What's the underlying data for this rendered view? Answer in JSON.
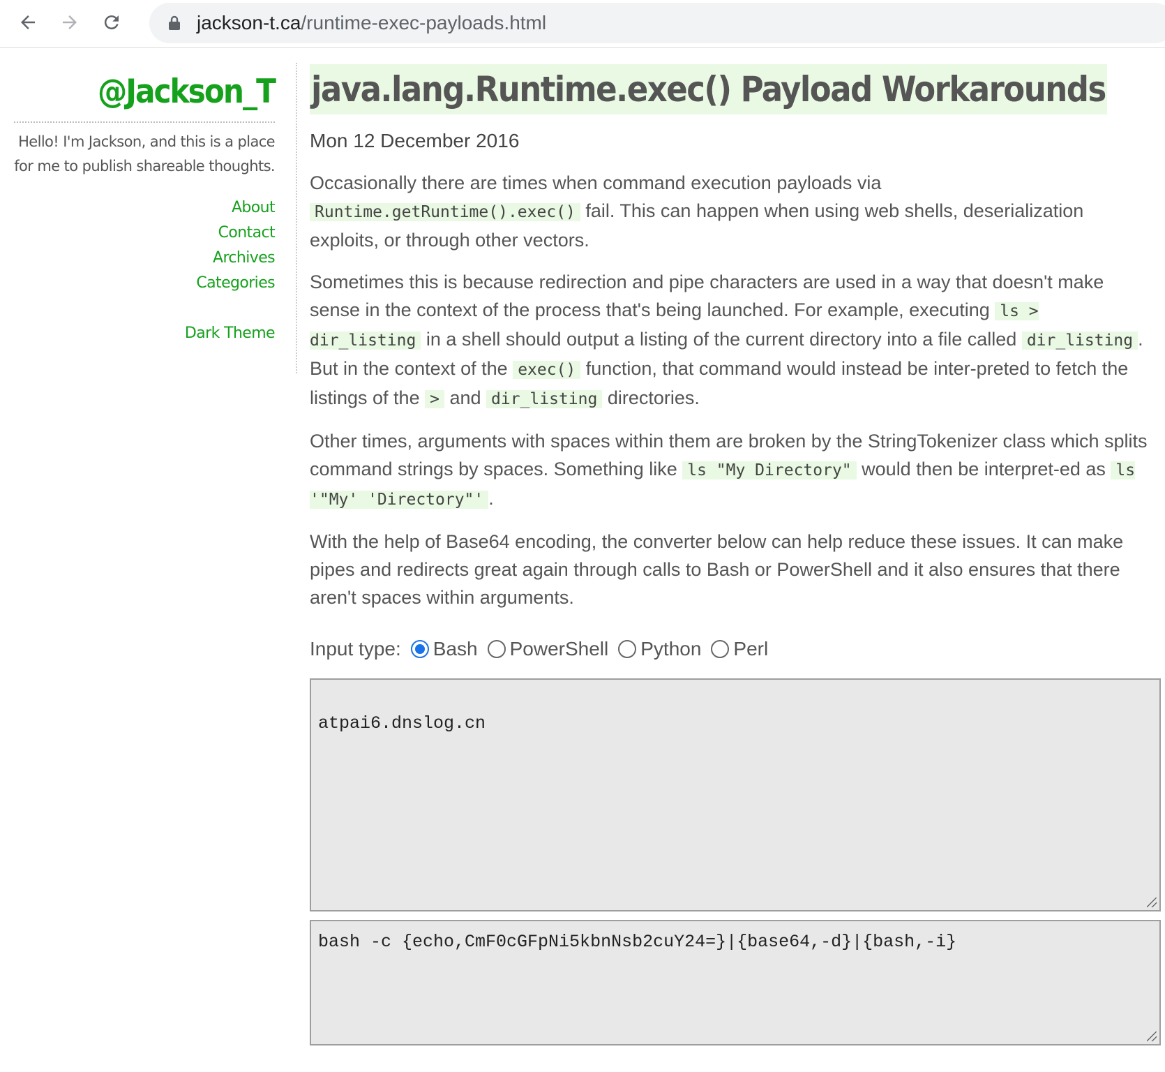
{
  "browser": {
    "url_host": "jackson-t.ca",
    "url_path": "/runtime-exec-payloads.html",
    "icons": [
      "back-arrow-icon",
      "forward-arrow-icon",
      "reload-icon",
      "lock-icon"
    ]
  },
  "sidebar": {
    "title": "@Jackson_T",
    "tagline_line1": "Hello! I'm Jackson, and this is a place",
    "tagline_line2": "for me to publish shareable thoughts.",
    "links": [
      "About",
      "Contact",
      "Archives",
      "Categories"
    ],
    "dark_theme": "Dark Theme",
    "link_color": "#16a11c"
  },
  "post": {
    "title": "java.lang.Runtime.exec() Payload Workarounds",
    "date": "Mon 12 December 2016",
    "p1": {
      "a": "Occasionally there are times when command execution payloads via ",
      "code1": "Runtime.getRuntime().exec()",
      "b": " fail. This can happen when using web shells, deserialization exploits, or through other vectors."
    },
    "p2": {
      "a": "Sometimes this is because redirection and pipe characters are used in a way that doesn't make sense in the context of the process that's being launched. For example, executing ",
      "code1": "ls > dir_listing",
      "b": " in a shell should output a listing of the current directory into a file called ",
      "code2": "dir_listing",
      "c": ". But in the context of the ",
      "code3": "exec()",
      "d": " function, that command would instead be inter-preted to fetch the listings of the ",
      "code4": ">",
      "e": " and ",
      "code5": "dir_listing",
      "f": " directories."
    },
    "p3": {
      "a": "Other times, arguments with spaces within them are broken by the StringTokenizer class which splits command strings by spaces. Something like ",
      "code1": "ls \"My Directory\"",
      "b": " would then be interpret-ed as ",
      "code2": "ls '\"My' 'Directory\"'",
      "c": "."
    },
    "p4": "With the help of Base64 encoding, the converter below can help reduce these issues. It can make pipes and redirects great again through calls to Bash or PowerShell and it also ensures that there aren't spaces within arguments."
  },
  "converter": {
    "input_type_label": "Input type:",
    "options": [
      "Bash",
      "PowerShell",
      "Python",
      "Perl"
    ],
    "selected": "Bash",
    "input_value": "atpai6.dnslog.cn",
    "output_value": "bash -c {echo,CmF0cGFpNi5kbnNsb2cuY24=}|{base64,-d}|{bash,-i}"
  }
}
